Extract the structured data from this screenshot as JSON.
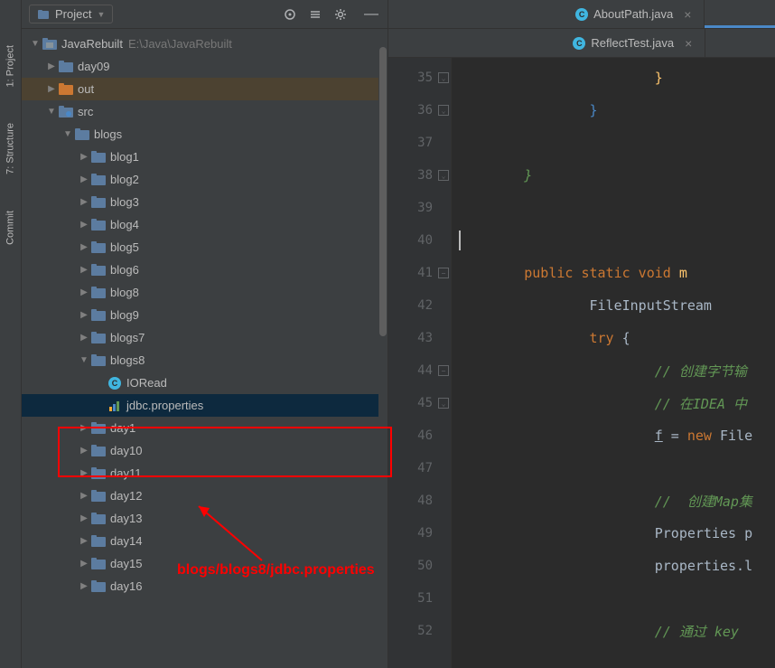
{
  "sideTabs": [
    {
      "label": "1: Project",
      "icon": "📁"
    },
    {
      "label": "7: Structure",
      "icon": "⋮"
    },
    {
      "label": "Commit",
      "icon": "◇"
    }
  ],
  "projectHeader": {
    "label": "Project"
  },
  "tree": {
    "root": {
      "name": "JavaRebuilt",
      "path": "E:\\Java\\JavaRebuilt"
    },
    "nodes": [
      {
        "indent": 0,
        "arrow": "expanded",
        "icon": "module",
        "label": "JavaRebuilt",
        "path": "E:\\Java\\JavaRebuilt"
      },
      {
        "indent": 1,
        "arrow": "collapsed",
        "icon": "folder-blue",
        "label": "day09"
      },
      {
        "indent": 1,
        "arrow": "collapsed",
        "icon": "folder-orange",
        "label": "out",
        "selected": "out"
      },
      {
        "indent": 1,
        "arrow": "expanded",
        "icon": "folder-src",
        "label": "src"
      },
      {
        "indent": 2,
        "arrow": "expanded",
        "icon": "folder-blue",
        "label": "blogs"
      },
      {
        "indent": 3,
        "arrow": "collapsed",
        "icon": "folder-blue",
        "label": "blog1"
      },
      {
        "indent": 3,
        "arrow": "collapsed",
        "icon": "folder-blue",
        "label": "blog2"
      },
      {
        "indent": 3,
        "arrow": "collapsed",
        "icon": "folder-blue",
        "label": "blog3"
      },
      {
        "indent": 3,
        "arrow": "collapsed",
        "icon": "folder-blue",
        "label": "blog4"
      },
      {
        "indent": 3,
        "arrow": "collapsed",
        "icon": "folder-blue",
        "label": "blog5"
      },
      {
        "indent": 3,
        "arrow": "collapsed",
        "icon": "folder-blue",
        "label": "blog6"
      },
      {
        "indent": 3,
        "arrow": "collapsed",
        "icon": "folder-blue",
        "label": "blog8"
      },
      {
        "indent": 3,
        "arrow": "collapsed",
        "icon": "folder-blue",
        "label": "blog9"
      },
      {
        "indent": 3,
        "arrow": "collapsed",
        "icon": "folder-blue",
        "label": "blogs7"
      },
      {
        "indent": 3,
        "arrow": "expanded",
        "icon": "folder-blue",
        "label": "blogs8"
      },
      {
        "indent": 4,
        "arrow": "none",
        "icon": "code",
        "label": "IORead"
      },
      {
        "indent": 4,
        "arrow": "none",
        "icon": "props",
        "label": "jdbc.properties",
        "selected": "true"
      },
      {
        "indent": 3,
        "arrow": "collapsed",
        "icon": "folder-blue",
        "label": "day1"
      },
      {
        "indent": 3,
        "arrow": "collapsed",
        "icon": "folder-blue",
        "label": "day10"
      },
      {
        "indent": 3,
        "arrow": "collapsed",
        "icon": "folder-blue",
        "label": "day11"
      },
      {
        "indent": 3,
        "arrow": "collapsed",
        "icon": "folder-blue",
        "label": "day12"
      },
      {
        "indent": 3,
        "arrow": "collapsed",
        "icon": "folder-blue",
        "label": "day13"
      },
      {
        "indent": 3,
        "arrow": "collapsed",
        "icon": "folder-blue",
        "label": "day14"
      },
      {
        "indent": 3,
        "arrow": "collapsed",
        "icon": "folder-blue",
        "label": "day15"
      },
      {
        "indent": 3,
        "arrow": "collapsed",
        "icon": "folder-blue",
        "label": "day16"
      }
    ]
  },
  "tabs": {
    "row1": [
      {
        "label": "AboutPath.java",
        "active": false
      }
    ],
    "row2": [
      {
        "label": "ReflectTest.java",
        "active": false
      }
    ]
  },
  "code": {
    "startLine": 35,
    "lines": [
      {
        "n": 35,
        "fold": "close",
        "segs": [
          {
            "t": "                        ",
            "c": ""
          },
          {
            "t": "}",
            "c": "brace-y"
          }
        ]
      },
      {
        "n": 36,
        "fold": "close",
        "segs": [
          {
            "t": "                ",
            "c": ""
          },
          {
            "t": "}",
            "c": "brace-b"
          }
        ]
      },
      {
        "n": 37,
        "segs": []
      },
      {
        "n": 38,
        "fold": "close",
        "segs": [
          {
            "t": "        ",
            "c": ""
          },
          {
            "t": "}",
            "c": "k-comment"
          }
        ]
      },
      {
        "n": 39,
        "segs": []
      },
      {
        "n": 40,
        "cursor": true,
        "segs": []
      },
      {
        "n": 41,
        "fold": "open",
        "segs": [
          {
            "t": "        ",
            "c": ""
          },
          {
            "t": "public static void ",
            "c": "k-orange"
          },
          {
            "t": "m",
            "c": "brace-y"
          }
        ]
      },
      {
        "n": 42,
        "segs": [
          {
            "t": "                ",
            "c": ""
          },
          {
            "t": "FileInputStream ",
            "c": "k-white"
          }
        ]
      },
      {
        "n": 43,
        "segs": [
          {
            "t": "                ",
            "c": ""
          },
          {
            "t": "try ",
            "c": "k-orange"
          },
          {
            "t": "{",
            "c": "k-white"
          }
        ]
      },
      {
        "n": 44,
        "fold": "open",
        "segs": [
          {
            "t": "                        ",
            "c": ""
          },
          {
            "t": "// 创建字节输",
            "c": "k-comment"
          }
        ]
      },
      {
        "n": 45,
        "fold": "close",
        "segs": [
          {
            "t": "                        ",
            "c": ""
          },
          {
            "t": "// 在IDEA 中",
            "c": "k-comment"
          }
        ]
      },
      {
        "n": 46,
        "segs": [
          {
            "t": "                        ",
            "c": ""
          },
          {
            "t": "f",
            "c": "k-white underline"
          },
          {
            "t": " = ",
            "c": "k-white"
          },
          {
            "t": "new ",
            "c": "k-orange"
          },
          {
            "t": "File",
            "c": "k-white"
          }
        ]
      },
      {
        "n": 47,
        "segs": []
      },
      {
        "n": 48,
        "segs": [
          {
            "t": "                        ",
            "c": ""
          },
          {
            "t": "//  创建Map集",
            "c": "k-comment"
          }
        ]
      },
      {
        "n": 49,
        "segs": [
          {
            "t": "                        ",
            "c": ""
          },
          {
            "t": "Properties p",
            "c": "k-white"
          }
        ]
      },
      {
        "n": 50,
        "segs": [
          {
            "t": "                        ",
            "c": ""
          },
          {
            "t": "properties.l",
            "c": "k-white"
          }
        ]
      },
      {
        "n": 51,
        "segs": []
      },
      {
        "n": 52,
        "segs": [
          {
            "t": "                        ",
            "c": ""
          },
          {
            "t": "// 通过 key",
            "c": "k-comment"
          }
        ]
      }
    ]
  },
  "annotation": {
    "text": "blogs/blogs8/jdbc.properties"
  }
}
